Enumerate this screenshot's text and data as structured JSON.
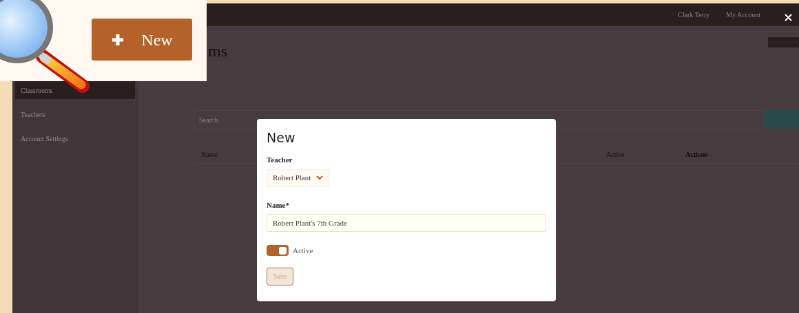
{
  "top_bar": {
    "links": [
      "Clark Terry",
      "My Account"
    ]
  },
  "sidebar": {
    "items": [
      {
        "label": "Classrooms",
        "selected": true
      },
      {
        "label": "Teachers",
        "selected": false
      },
      {
        "label": "Account Settings",
        "selected": false
      }
    ]
  },
  "page": {
    "title": "ms",
    "search": {
      "placeholder": "Search"
    },
    "table": {
      "columns": [
        "Name",
        "Active",
        "Actions"
      ]
    }
  },
  "callout": {
    "button": "New"
  },
  "modal": {
    "title": "New",
    "teacher": {
      "label": "Teacher",
      "value": "Robert Plant"
    },
    "name": {
      "label": "Name*",
      "value": "Robert Plant's 7th Grade"
    },
    "active": {
      "label": "Active",
      "on": true
    },
    "save": {
      "label": "Save",
      "disabled": true
    }
  }
}
